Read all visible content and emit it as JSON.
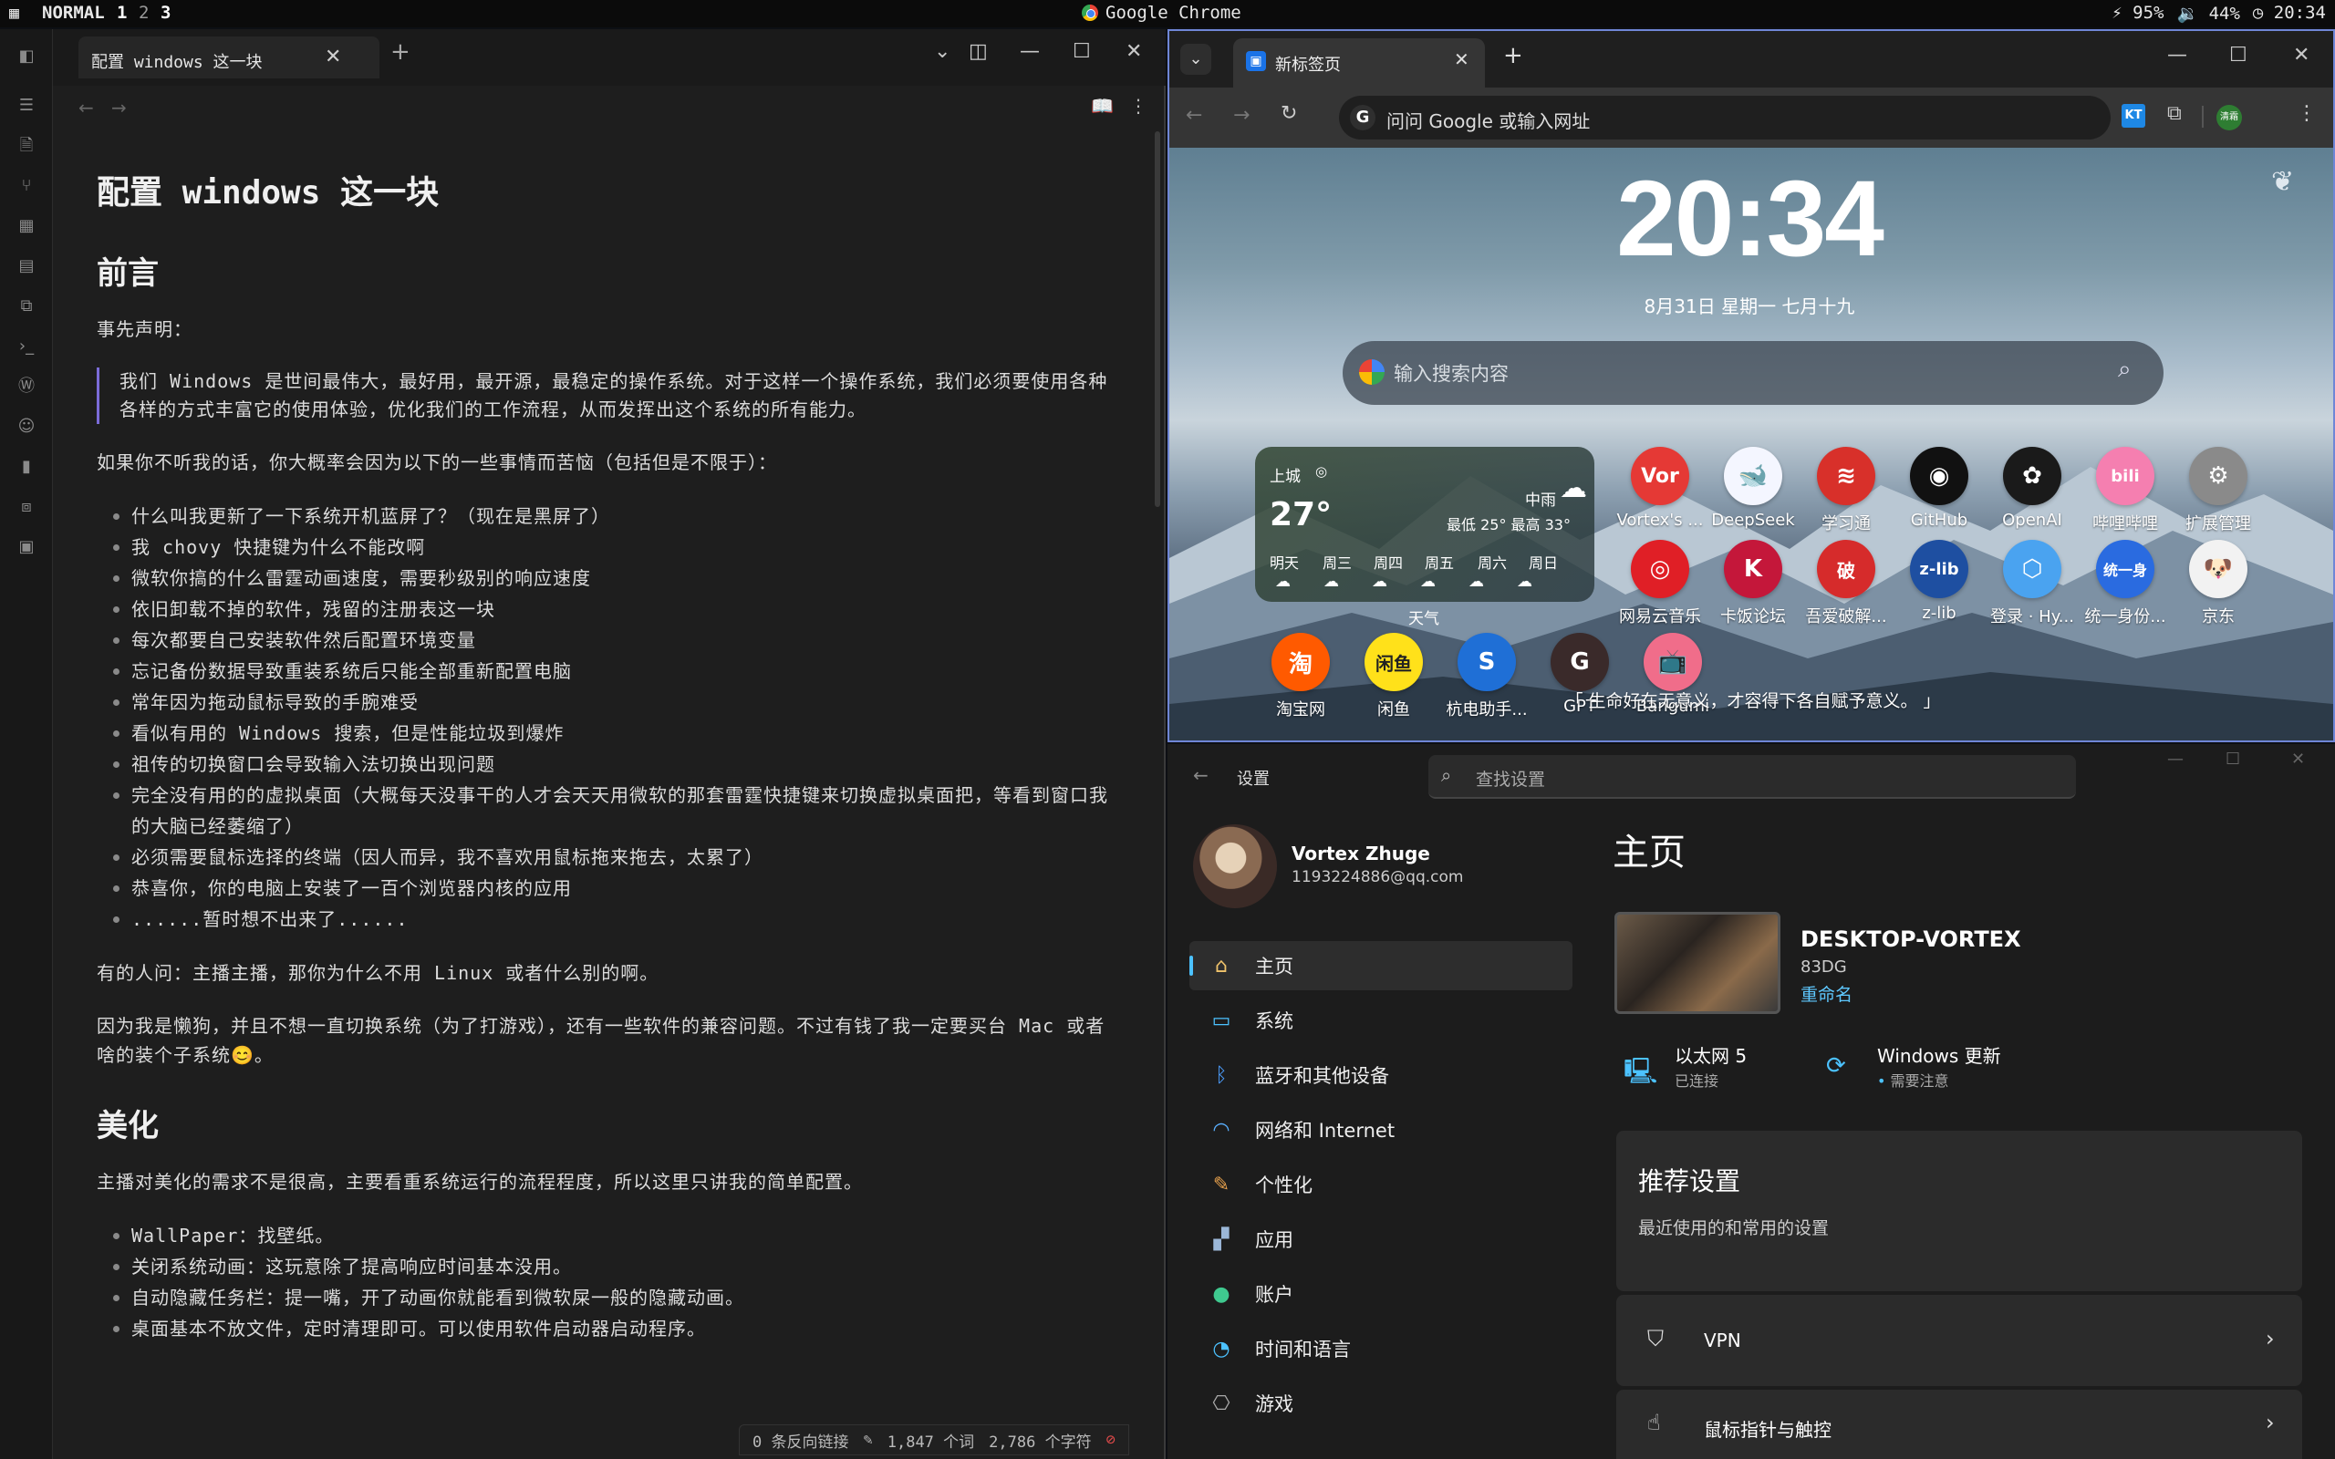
{
  "topbar": {
    "mode": "NORMAL",
    "workspaces": [
      "1",
      "2",
      "3"
    ],
    "active_app": "Google Chrome",
    "status": [
      "95%",
      "44%",
      "20:34"
    ]
  },
  "obsidian": {
    "tab_title": "配置 windows 这一块",
    "doc": {
      "title": "配置 windows 这一块",
      "h_preface": "前言",
      "disclaimer": "事先声明：",
      "quote": "我们 Windows 是世间最伟大，最好用，最开源，最稳定的操作系统。对于这样一个操作系统，我们必须要使用各种各样的方式丰富它的使用体验，优化我们的工作流程，从而发挥出这个系统的所有能力。",
      "p_ifnot": "如果你不听我的话，你大概率会因为以下的一些事情而苦恼（包括但是不限于）：",
      "list1": [
        "什么叫我更新了一下系统开机蓝屏了？（现在是黑屏了）",
        "我 chovy 快捷键为什么不能改啊",
        "微软你搞的什么雷霆动画速度，需要秒级别的响应速度",
        "依旧卸载不掉的软件，残留的注册表这一块",
        "每次都要自己安装软件然后配置环境变量",
        "忘记备份数据导致重装系统后只能全部重新配置电脑",
        "常年因为拖动鼠标导致的手腕难受",
        "看似有用的 Windows 搜索，但是性能垃圾到爆炸",
        "祖传的切换窗口会导致输入法切换出现问题",
        "完全没有用的的虚拟桌面（大概每天没事干的人才会天天用微软的那套雷霆快捷键来切换虚拟桌面把，等看到窗口我的大脑已经萎缩了）",
        "必须需要鼠标选择的终端（因人而异，我不喜欢用鼠标拖来拖去，太累了）",
        "恭喜你，你的电脑上安装了一百个浏览器内核的应用",
        "......暂时想不出来了......"
      ],
      "p_ask": "有的人问：主播主播，那你为什么不用 Linux 或者什么别的啊。",
      "p_because": "因为我是懒狗，并且不想一直切换系统（为了打游戏），还有一些软件的兼容问题。不过有钱了我一定要买台 Mac 或者啥的装个子系统😊。",
      "h_beauty": "美化",
      "p_beauty": "主播对美化的需求不是很高，主要看重系统运行的流程程度，所以这里只讲我的简单配置。",
      "list2": [
        "WallPaper：找壁纸。",
        "关闭系统动画：这玩意除了提高响应时间基本没用。",
        "自动隐藏任务栏：提一嘴，开了动画你就能看到微软屎一般的隐藏动画。",
        "桌面基本不放文件，定时清理即可。可以使用软件启动器启动程序。"
      ]
    },
    "status": {
      "backlinks": "0 条反向链接",
      "words": "1,847 个词",
      "chars": "2,786 个字符"
    }
  },
  "chrome": {
    "tab_title": "新标签页",
    "omnibox_placeholder": "问问 Google 或输入网址",
    "ext_label": "KT",
    "profile_label": "清霜",
    "newtab": {
      "time": "20:34",
      "date": "8月31日  星期一  七月十九",
      "search_placeholder": "输入搜索内容",
      "weather": {
        "location": "上城",
        "temp": "27°",
        "condition": "中雨",
        "range": "最低 25° 最高 33°",
        "days": [
          "明天",
          "周三",
          "周四",
          "周五",
          "周六",
          "周日"
        ],
        "caption": "天气"
      },
      "shortcuts": [
        {
          "label": "Vortex's ...",
          "icon": "Vor",
          "color": "#e53935"
        },
        {
          "label": "DeepSeek",
          "icon": "🐋",
          "color": "#f4f6ff"
        },
        {
          "label": "学习通",
          "icon": "≋",
          "color": "#d8302a"
        },
        {
          "label": "GitHub",
          "icon": "◉",
          "color": "#111111"
        },
        {
          "label": "OpenAI",
          "icon": "✿",
          "color": "#1a1a1a"
        },
        {
          "label": "哔哩哔哩",
          "icon": "bili",
          "color": "#f57fb0"
        },
        {
          "label": "扩展管理",
          "icon": "⚙",
          "color": "#8a8a8a"
        },
        {
          "label": "网易云音乐",
          "icon": "◎",
          "color": "#e01f26"
        },
        {
          "label": "卡饭论坛",
          "icon": "K",
          "color": "#c4173a"
        },
        {
          "label": "吾爱破解...",
          "icon": "破",
          "color": "#d62b2b"
        },
        {
          "label": "z-lib",
          "icon": "z-lib",
          "color": "#1e4fa1"
        },
        {
          "label": "登录 · Hy...",
          "icon": "⬡",
          "color": "#4aa3f0"
        },
        {
          "label": "统一身份...",
          "icon": "统一身",
          "color": "#2a6be0"
        },
        {
          "label": "京东",
          "icon": "🐶",
          "color": "#f2f2f2"
        },
        {
          "label": "淘宝网",
          "icon": "淘",
          "color": "#ff5a00"
        },
        {
          "label": "闲鱼",
          "icon": "闲鱼",
          "color": "#ffe11a"
        },
        {
          "label": "杭电助手...",
          "icon": "S",
          "color": "#1f6fd6"
        },
        {
          "label": "GPT",
          "icon": "G",
          "color": "#3a2a2a"
        },
        {
          "label": "Bangumi",
          "icon": "📺",
          "color": "#f06d8a"
        }
      ],
      "quote": "「 生命好在无意义，才容得下各自赋予意义。 」"
    }
  },
  "settings": {
    "app_title": "设置",
    "search_placeholder": "查找设置",
    "user": {
      "name": "Vortex Zhuge",
      "email": "1193224886@qq.com"
    },
    "nav": [
      {
        "label": "主页",
        "icon": "home-icon"
      },
      {
        "label": "系统",
        "icon": "monitor-icon"
      },
      {
        "label": "蓝牙和其他设备",
        "icon": "bluetooth-icon"
      },
      {
        "label": "网络和 Internet",
        "icon": "wifi-icon"
      },
      {
        "label": "个性化",
        "icon": "brush-icon"
      },
      {
        "label": "应用",
        "icon": "apps-icon"
      },
      {
        "label": "账户",
        "icon": "account-icon"
      },
      {
        "label": "时间和语言",
        "icon": "globe-clock-icon"
      },
      {
        "label": "游戏",
        "icon": "gamepad-icon"
      }
    ],
    "page_title": "主页",
    "device": {
      "name": "DESKTOP-VORTEX",
      "model": "83DG",
      "rename": "重命名"
    },
    "ethernet": {
      "title": "以太网 5",
      "status": "已连接"
    },
    "update": {
      "title": "Windows 更新",
      "status": "需要注意"
    },
    "recommended": {
      "title": "推荐设置",
      "subtitle": "最近使用的和常用的设置"
    },
    "rows": [
      {
        "label": "VPN"
      },
      {
        "label": "鼠标指针与触控"
      }
    ]
  }
}
